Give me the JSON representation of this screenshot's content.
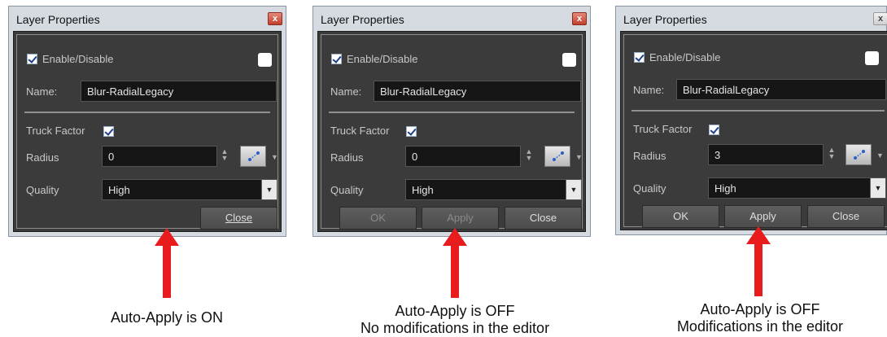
{
  "dialogs": [
    {
      "title": "Layer Properties",
      "enable_label": "Enable/Disable",
      "name_label": "Name:",
      "name_value": "Blur-RadialLegacy",
      "truck_factor_label": "Truck Factor",
      "radius_label": "Radius",
      "radius_value": "0",
      "quality_label": "Quality",
      "quality_value": "High",
      "close_label": "Close"
    },
    {
      "title": "Layer Properties",
      "enable_label": "Enable/Disable",
      "name_label": "Name:",
      "name_value": "Blur-RadialLegacy",
      "truck_factor_label": "Truck Factor",
      "radius_label": "Radius",
      "radius_value": "0",
      "quality_label": "Quality",
      "quality_value": "High",
      "ok_label": "OK",
      "apply_label": "Apply",
      "close_label": "Close"
    },
    {
      "title": "Layer Properties",
      "enable_label": "Enable/Disable",
      "name_label": "Name:",
      "name_value": "Blur-RadialLegacy",
      "truck_factor_label": "Truck Factor",
      "radius_label": "Radius",
      "radius_value": "3",
      "quality_label": "Quality",
      "quality_value": "High",
      "ok_label": "OK",
      "apply_label": "Apply",
      "close_label": "Close"
    }
  ],
  "captions": [
    {
      "line1": "Auto-Apply is ON"
    },
    {
      "line1": "Auto-Apply is OFF",
      "line2": "No modifications in the editor"
    },
    {
      "line1": "Auto-Apply is OFF",
      "line2": "Modifications in the editor"
    }
  ],
  "colors": {
    "panel_background": "#3b3b3b",
    "frame": "#d6dbe2",
    "arrow": "#e81c1c"
  }
}
